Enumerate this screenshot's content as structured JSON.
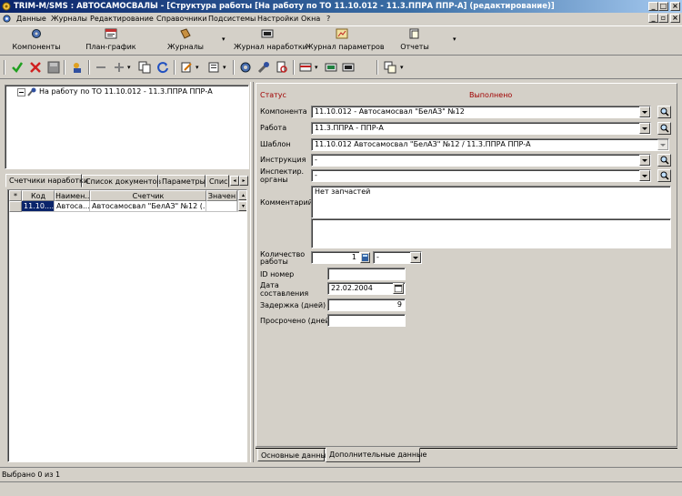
{
  "window": {
    "title": "TRIM-M/SMS : АВТОСАМОСВАЛЫ - [Структура работы [На работу по ТО 11.10.012 - 11.3.ППРА ППР-А] (редактирование)]"
  },
  "menu": [
    "Данные",
    "Журналы",
    "Редактирование",
    "Справочники",
    "Подсистемы",
    "Настройки",
    "Окна",
    "?"
  ],
  "big_toolbar": {
    "components": "Компоненты",
    "schedule": "План-график",
    "journals": "Журналы",
    "runtime_journal": "Журнал наработки",
    "params_journal": "Журнал параметров",
    "reports": "Отчеты"
  },
  "tree": {
    "root": "На работу по ТО 11.10.012 - 11.3.ППРА ППР-А"
  },
  "left_tabs": [
    "Счетчики наработки",
    "Список документов",
    "Параметры",
    "Спис"
  ],
  "grid": {
    "headers": [
      "*",
      "Код",
      "Наимен...",
      "Счетчик",
      "Значен"
    ],
    "rows": [
      [
        "",
        "11.10....",
        "Автоса...",
        "Автосамосвал \"БелАЗ\" №12 (...",
        ""
      ]
    ]
  },
  "form": {
    "status_label": "Статус",
    "status_value": "Выполнено",
    "component_label": "Компонента",
    "component_value": "11.10.012 - Автосамосвал \"БелАЗ\" №12",
    "work_label": "Работа",
    "work_value": "11.3.ППРА - ППР-А",
    "template_label": "Шаблон",
    "template_value": "11.10.012 Автосамосвал \"БелАЗ\" №12 / 11.3.ППРА ППР-А",
    "instruction_label": "Инструкция",
    "instruction_value": "-",
    "inspect_label_1": "Инспектир.",
    "inspect_label_2": "органы",
    "inspect_value": "-",
    "comment_label": "Комментарий",
    "comment_value": "Нет запчастей",
    "qty_label_1": "Количество",
    "qty_label_2": "работы",
    "qty_value": "1",
    "qty_unit": "-",
    "id_label": "ID номер",
    "id_value": "",
    "date_label_1": "Дата",
    "date_label_2": "составления",
    "date_value": "22.02.2004",
    "delay_label": "Задержка (дней)",
    "delay_value": "9",
    "overdue_label": "Просрочено (дней)",
    "overdue_value": ""
  },
  "bottom_tabs": [
    "Основные данные",
    "Дополнительные данные"
  ],
  "status_bar": "Выбрано 0 из 1",
  "colors": {
    "status_red": "#a00000",
    "selection": "#0a246a",
    "face": "#d4d0c8"
  }
}
